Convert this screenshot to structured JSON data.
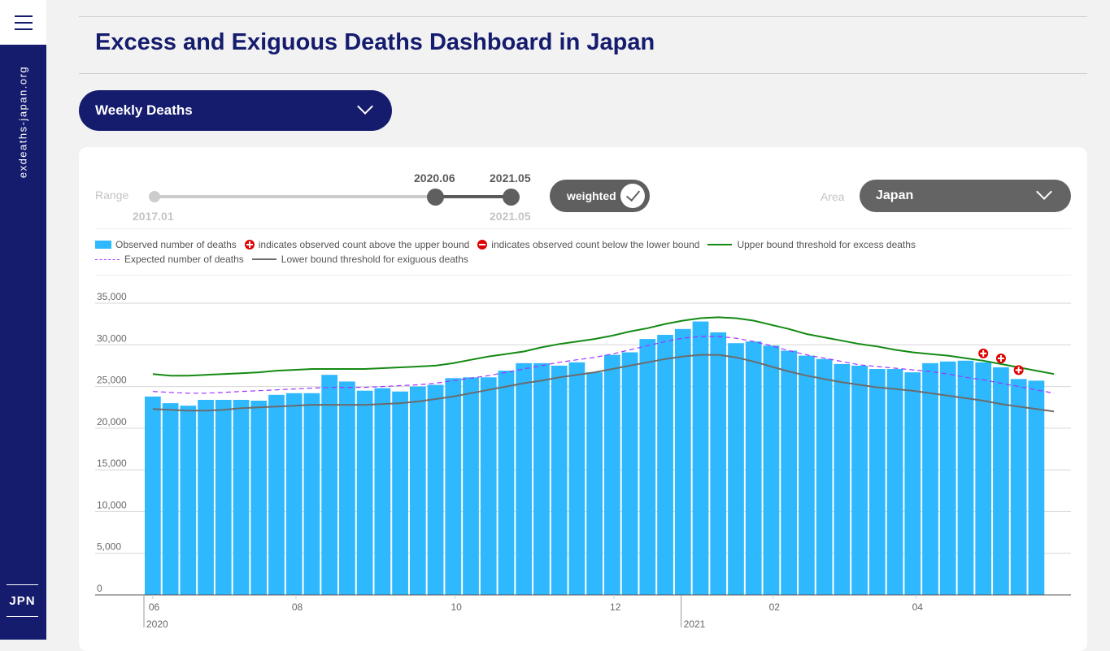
{
  "sidebar": {
    "site_label": "exdeaths-japan.org",
    "lang_label": "JPN",
    "menu_icon": "hamburger-icon"
  },
  "header": {
    "title": "Excess and Exiguous Deaths Dashboard in Japan"
  },
  "metric_select": {
    "value": "Weekly Deaths"
  },
  "controls": {
    "range_label": "Range",
    "range_min": "2017.01",
    "range_max": "2021.05",
    "range_start": "2020.06",
    "range_end": "2021.05",
    "weighted_label": "weighted",
    "weighted_checked": true,
    "area_label": "Area",
    "area_value": "Japan"
  },
  "legend": {
    "observed": "Observed number of deaths",
    "above": "indicates observed count above the upper bound",
    "below": "indicates observed count below the lower bound",
    "upper": "Upper bound threshold for excess deaths",
    "expected": "Expected number of deaths",
    "lower": "Lower bound threshold for exiguous deaths"
  },
  "colors": {
    "bar": "#2eb8fe",
    "upper": "#138a13",
    "lower": "#6c6c6c",
    "expected": "#a033ff",
    "flag": "#dd0000",
    "brand": "#151c6e"
  },
  "chart_data": {
    "type": "bar",
    "title": "",
    "xlabel": "",
    "ylabel": "",
    "ylim": [
      0,
      35000
    ],
    "yticks": [
      0,
      5000,
      10000,
      15000,
      20000,
      25000,
      30000,
      35000
    ],
    "ytick_labels": [
      "0",
      "5,000",
      "10,000",
      "15,000",
      "20,000",
      "25,000",
      "30,000",
      "35,000"
    ],
    "grid": true,
    "legend_position": "top",
    "x_month_ticks": [
      {
        "label": "06",
        "week": 0.5
      },
      {
        "label": "08",
        "week": 8.6
      },
      {
        "label": "10",
        "week": 17.6
      },
      {
        "label": "12",
        "week": 26.6
      },
      {
        "label": "02",
        "week": 35.6
      },
      {
        "label": "04",
        "week": 43.7
      }
    ],
    "x_year_ticks": [
      {
        "label": "2020",
        "week": -0.5
      },
      {
        "label": "2021",
        "week": 29.9
      }
    ],
    "series": [
      {
        "name": "Observed number of deaths",
        "type": "bar",
        "values": [
          23800,
          23000,
          22700,
          23400,
          23400,
          23400,
          23300,
          24000,
          24200,
          24200,
          26400,
          25600,
          24500,
          24800,
          24400,
          25000,
          25200,
          26000,
          26100,
          26100,
          26900,
          27800,
          27800,
          27500,
          27900,
          26700,
          28800,
          29100,
          30700,
          31200,
          31900,
          32800,
          31500,
          30200,
          30400,
          29900,
          29300,
          28700,
          28300,
          27700,
          27500,
          27100,
          27100,
          26700,
          27800,
          28000,
          28100,
          27900,
          27300,
          25900,
          25700
        ]
      },
      {
        "name": "Upper bound threshold for excess deaths",
        "type": "line",
        "values": [
          26500,
          26300,
          26300,
          26400,
          26500,
          26600,
          26700,
          26900,
          27000,
          27100,
          27100,
          27100,
          27100,
          27200,
          27300,
          27400,
          27500,
          27800,
          28200,
          28600,
          28900,
          29200,
          29700,
          30100,
          30400,
          30700,
          31100,
          31600,
          32000,
          32500,
          32900,
          33200,
          33300,
          33200,
          32900,
          32400,
          31900,
          31300,
          30900,
          30500,
          30100,
          29800,
          29400,
          29100,
          28900,
          28700,
          28400,
          28100,
          27700,
          27300,
          26900,
          26500
        ]
      },
      {
        "name": "Expected number of deaths",
        "type": "line",
        "values": [
          24400,
          24300,
          24200,
          24200,
          24300,
          24400,
          24500,
          24600,
          24700,
          24800,
          24900,
          24900,
          24900,
          25000,
          25100,
          25200,
          25400,
          25700,
          26000,
          26300,
          26700,
          27100,
          27500,
          27900,
          28200,
          28500,
          28900,
          29400,
          29900,
          30400,
          30800,
          31000,
          31000,
          30800,
          30400,
          29900,
          29300,
          28800,
          28400,
          28000,
          27600,
          27400,
          27200,
          27000,
          26800,
          26500,
          26100,
          25800,
          25400,
          25000,
          24600,
          24200
        ]
      },
      {
        "name": "Lower bound threshold for exiguous deaths",
        "type": "line",
        "values": [
          22300,
          22200,
          22100,
          22100,
          22200,
          22400,
          22500,
          22600,
          22700,
          22800,
          22800,
          22800,
          22800,
          22900,
          23000,
          23200,
          23500,
          23800,
          24200,
          24600,
          25000,
          25400,
          25700,
          26100,
          26400,
          26700,
          27100,
          27500,
          27900,
          28300,
          28600,
          28800,
          28800,
          28500,
          28000,
          27400,
          26800,
          26300,
          25900,
          25500,
          25200,
          24900,
          24700,
          24500,
          24200,
          23900,
          23600,
          23300,
          22900,
          22600,
          22300,
          22000
        ]
      },
      {
        "name": "indicates observed count above the upper bound",
        "type": "marker",
        "indices": [
          47,
          48,
          49
        ]
      }
    ]
  }
}
